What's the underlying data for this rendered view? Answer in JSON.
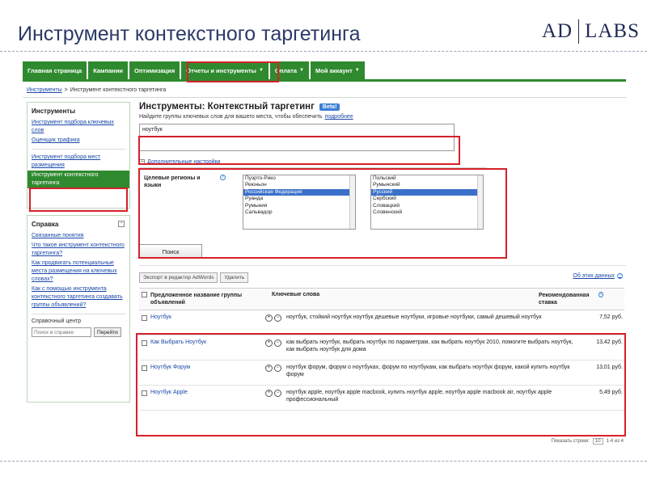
{
  "slide": {
    "title": "Инструмент контекстного таргетинга",
    "logo_left": "AD",
    "logo_right": "LABS"
  },
  "nav": {
    "tabs": [
      {
        "label": "Главная страница",
        "caret": ""
      },
      {
        "label": "Кампании",
        "caret": ""
      },
      {
        "label": "Оптимизация",
        "caret": ""
      },
      {
        "label": "Отчеты и инструменты",
        "caret": "▼"
      },
      {
        "label": "Оплата",
        "caret": "▼"
      },
      {
        "label": "Мой аккаунт",
        "caret": "▼"
      }
    ]
  },
  "breadcrumb": {
    "parent": "Инструменты",
    "separator": ">",
    "current": "Инструмент контекстного таргетинга"
  },
  "sidebar": {
    "tools": {
      "title": "Инструменты",
      "items": [
        {
          "label": "Инструмент подбора ключевых слов"
        },
        {
          "label": "Оценщик трафика"
        },
        {
          "label": "Инструмент подбора мест размещения"
        },
        {
          "label": "Инструмент контекстного таргетинга"
        }
      ]
    },
    "help": {
      "title": "Справка",
      "collapse": "−",
      "items": [
        {
          "label": "Связанные понятия"
        },
        {
          "label": "Что такое инструмент контекстного таргетинга?"
        },
        {
          "label": "Как продвигать потенциальные места размещения на ключевых словах?"
        },
        {
          "label": "Как с помощью инструмента контекстного таргетинга создавать группы объявлений?"
        }
      ],
      "center_title": "Справочный центр",
      "search_placeholder": "Поиск в справке",
      "search_button": "Перейти"
    }
  },
  "main": {
    "title": "Инструменты: Контекстный таргетинг",
    "beta": "Beta!",
    "subtitle": "Найдите группы ключевых слов для вашего места, чтобы обеспечить",
    "subtitle_link": "подробнее",
    "keyword_value": "ноутбук",
    "advanced": {
      "toggle": "−",
      "label": "Дополнительные настройки",
      "field_label": "Целевые регионы и языки",
      "help": "?",
      "regions": [
        "Пуэрто-Рико",
        "Реюньон",
        "Российская Федерация",
        "Руанда",
        "Румыния",
        "Сальвадор"
      ],
      "regions_selected": "Российская Федерация",
      "languages": [
        "Польский",
        "Румынский",
        "Русский",
        "Сербский",
        "Словацкий",
        "Словенский"
      ],
      "languages_selected": "Русский"
    },
    "search_button": "Поиск",
    "toolbar": {
      "export": "Экспорт в редактор AdWords",
      "delete": "Удалить",
      "right_link": "Об этих данных",
      "right_help": "?"
    },
    "table": {
      "headers": {
        "group": "Предложенное название группы объявлений",
        "keywords": "Ключевые слова",
        "bid": "Рекомендованная ставка"
      },
      "rows": [
        {
          "group": "Ноутбук",
          "keywords": "ноутбук, стойкий ноутбук ноутбук дешевые ноутбуки, игровые ноутбуки, самый дешевый ноутбук",
          "bid": "7,52 руб."
        },
        {
          "group": "Как Выбрать Ноутбук",
          "keywords": "как выбрать ноутбук, выбрать ноутбук по параметрам, как выбрать ноутбук 2010, помогите выбрать ноутбук, как выбрать ноутбук для дома",
          "bid": "13,42 руб."
        },
        {
          "group": "Ноутбук Форум",
          "keywords": "ноутбук форум, форум о ноутбуках, форум по ноутбукам, как выбрать ноутбук форум, какой купить ноутбук форум",
          "bid": "13,01 руб."
        },
        {
          "group": "Ноутбук Apple",
          "keywords": "ноутбук apple, ноутбук apple macbook, купить ноутбук apple, ноутбук apple macbook air, ноутбук apple профессиональный",
          "bid": "5,49 руб."
        }
      ],
      "icon_plus": "+",
      "icon_minus": "−"
    },
    "pager": {
      "label": "Показать строки:",
      "rows": "10",
      "position": "1-4 из 4"
    }
  }
}
